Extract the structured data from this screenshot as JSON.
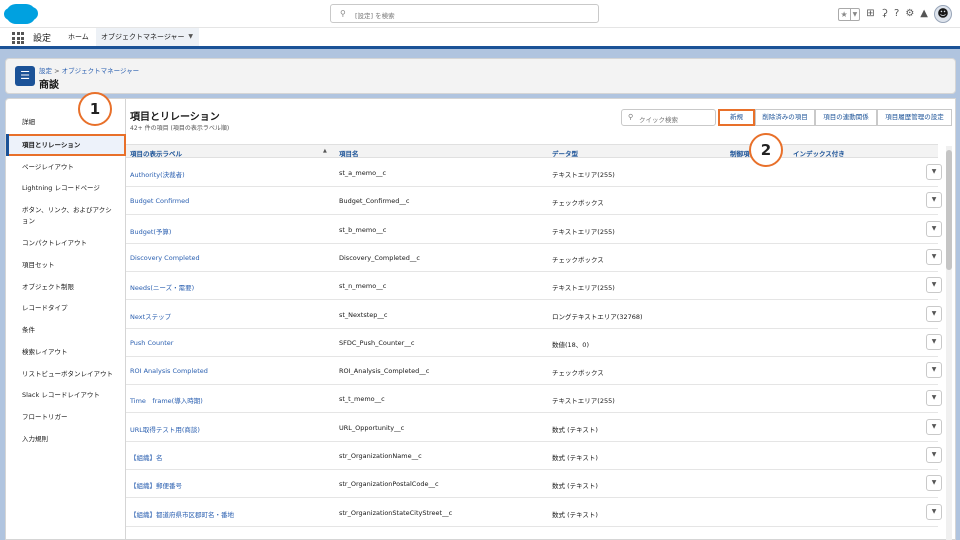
{
  "topbar": {
    "search_placeholder": "[設定] を検索",
    "icons": [
      "star-icon",
      "add-icon",
      "bell-icon",
      "help-icon",
      "gear-icon",
      "notification-icon",
      "avatar-icon"
    ]
  },
  "nav": {
    "app_name": "設定",
    "tabs": [
      {
        "label": "ホーム"
      },
      {
        "label": "オブジェクトマネージャー"
      }
    ]
  },
  "header": {
    "breadcrumb": [
      "設定",
      "オブジェクトマネージャー"
    ],
    "breadcrumb_sep": ">",
    "title": "商談"
  },
  "sidebar": {
    "items": [
      {
        "label": "詳細"
      },
      {
        "label": "項目とリレーション"
      },
      {
        "label": "ページレイアウト"
      },
      {
        "label": "Lightning レコードページ"
      },
      {
        "label": "ボタン、リンク、およびアクション"
      },
      {
        "label": "コンパクトレイアウト"
      },
      {
        "label": "項目セット"
      },
      {
        "label": "オブジェクト制限"
      },
      {
        "label": "レコードタイプ"
      },
      {
        "label": "条件"
      },
      {
        "label": "検索レイアウト"
      },
      {
        "label": "リストビューボタンレイアウト"
      },
      {
        "label": "Slack レコードレイアウト"
      },
      {
        "label": "フロートリガー"
      },
      {
        "label": "入力規則"
      }
    ]
  },
  "main": {
    "title": "項目とリレーション",
    "subtitle": "42+ 件の項目 (項目の表示ラベル順)",
    "quick_search_placeholder": "クイック検索",
    "buttons": {
      "new": "新規",
      "deleted": "削除済みの項目",
      "dependencies": "項目の連動関係",
      "history": "項目履歴管理の設定"
    },
    "columns": [
      "項目の表示ラベル",
      "項目名",
      "データ型",
      "制御項目",
      "インデックス付き"
    ],
    "rows": [
      [
        "Authority(決裁者)",
        "st_a_memo__c",
        "テキストエリア(255)"
      ],
      [
        "Budget Confirmed",
        "Budget_Confirmed__c",
        "チェックボックス"
      ],
      [
        "Budget(予算)",
        "st_b_memo__c",
        "テキストエリア(255)"
      ],
      [
        "Discovery Completed",
        "Discovery_Completed__c",
        "チェックボックス"
      ],
      [
        "Needs(ニーズ・需要)",
        "st_n_memo__c",
        "テキストエリア(255)"
      ],
      [
        "Nextステップ",
        "st_Nextstep__c",
        "ロングテキストエリア(32768)"
      ],
      [
        "Push Counter",
        "SFDC_Push_Counter__c",
        "数値(18、0)"
      ],
      [
        "ROI Analysis Completed",
        "ROI_Analysis_Completed__c",
        "チェックボックス"
      ],
      [
        "Time　frame(導入時期)",
        "st_t_memo__c",
        "テキストエリア(255)"
      ],
      [
        "URL取得テスト用(商談)",
        "URL_Opportunity__c",
        "数式 (テキスト)"
      ],
      [
        "【組織】名",
        "str_OrganizationName__c",
        "数式 (テキスト)"
      ],
      [
        "【組織】郵便番号",
        "str_OrganizationPostalCode__c",
        "数式 (テキスト)"
      ],
      [
        "【組織】都道府県市区郡町名・番地",
        "str_OrganizationStateCityStreet__c",
        "数式 (テキスト)"
      ]
    ]
  },
  "callouts": {
    "one": "1",
    "two": "2"
  }
}
